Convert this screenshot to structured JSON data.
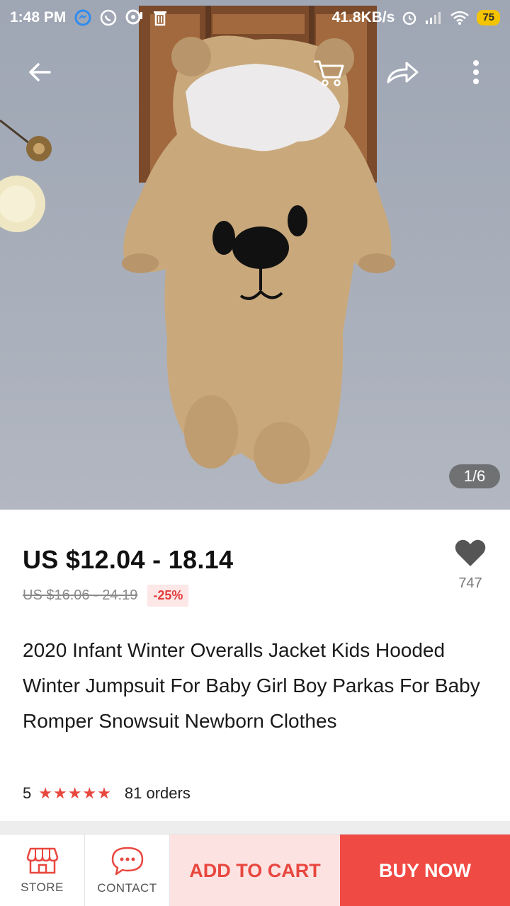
{
  "status_bar": {
    "time": "1:48 PM",
    "network_speed": "41.8KB/s",
    "battery": "75",
    "icons": [
      "messenger-icon",
      "whatsapp-icon",
      "chat-bubble-icon",
      "trash-icon",
      "alarm-icon",
      "signal-icon",
      "wifi-icon",
      "battery-icon"
    ]
  },
  "top_bar": {
    "icons": [
      "back-arrow-icon",
      "cart-icon",
      "share-icon",
      "more-vertical-icon"
    ]
  },
  "gallery": {
    "counter": "1/6"
  },
  "product": {
    "price": "US $12.04 - 18.14",
    "original_price": "US $16.06 - 24.19",
    "discount": "-25%",
    "wishlist_count": "747",
    "title": "2020 Infant Winter Overalls Jacket Kids Hooded Winter Jumpsuit For Baby Girl Boy Parkas For Baby Romper Snowsuit Newborn Clothes",
    "rating": "5",
    "stars": "★★★★★",
    "orders": "81 orders"
  },
  "bottom_bar": {
    "store_label": "STORE",
    "contact_label": "CONTACT",
    "add_to_cart_label": "ADD TO CART",
    "buy_now_label": "BUY NOW"
  },
  "colors": {
    "accent_red": "#f04a45",
    "light_red": "#fde2e2",
    "star_red": "#e8473f",
    "battery_yellow": "#f5c400"
  }
}
